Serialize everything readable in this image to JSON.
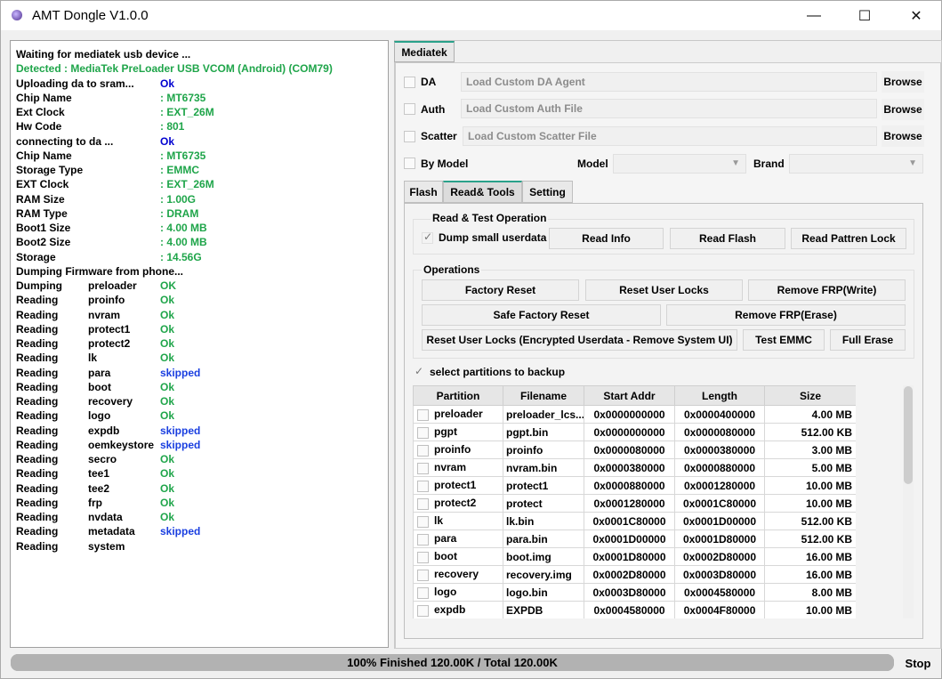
{
  "window": {
    "title": "AMT Dongle V1.0.0",
    "minimize": "—",
    "maximize": "☐",
    "close": "✕"
  },
  "log": [
    {
      "c1": "Waiting for mediatek usb device ...",
      "c2": "",
      "c3": "",
      "cls1": "",
      "cls3": ""
    },
    {
      "c1": "Detected  :  MediaTek PreLoader USB VCOM (Android) (COM79)",
      "c2": "",
      "c3": "",
      "cls1": "green",
      "cls3": ""
    },
    {
      "c1": "Uploading da to sram...",
      "c2": "",
      "c3": "Ok",
      "cls1": "",
      "cls3": "ok-blue"
    },
    {
      "c1": "Chip Name",
      "c2": "",
      "c3": ": MT6735",
      "cls1": "",
      "cls3": "ok-green"
    },
    {
      "c1": "Ext Clock",
      "c2": "",
      "c3": ": EXT_26M",
      "cls1": "",
      "cls3": "ok-green"
    },
    {
      "c1": "Hw Code",
      "c2": "",
      "c3": ": 801",
      "cls1": "",
      "cls3": "ok-green"
    },
    {
      "c1": "connecting to da ...",
      "c2": "",
      "c3": "Ok",
      "cls1": "",
      "cls3": "ok-blue"
    },
    {
      "c1": "Chip Name",
      "c2": "",
      "c3": ": MT6735",
      "cls1": "",
      "cls3": "ok-green"
    },
    {
      "c1": "Storage Type",
      "c2": "",
      "c3": ": EMMC",
      "cls1": "",
      "cls3": "ok-green"
    },
    {
      "c1": "EXT Clock",
      "c2": "",
      "c3": ": EXT_26M",
      "cls1": "",
      "cls3": "ok-green"
    },
    {
      "c1": "RAM Size",
      "c2": "",
      "c3": ": 1.00G",
      "cls1": "",
      "cls3": "ok-green"
    },
    {
      "c1": "RAM Type",
      "c2": "",
      "c3": ": DRAM",
      "cls1": "",
      "cls3": "ok-green"
    },
    {
      "c1": "Boot1 Size",
      "c2": "",
      "c3": ": 4.00 MB",
      "cls1": "",
      "cls3": "ok-green"
    },
    {
      "c1": "Boot2 Size",
      "c2": "",
      "c3": ": 4.00 MB",
      "cls1": "",
      "cls3": "ok-green"
    },
    {
      "c1": "Storage",
      "c2": "",
      "c3": ": 14.56G",
      "cls1": "",
      "cls3": "ok-green"
    },
    {
      "c1": "Dumping Firmware from phone...",
      "c2": "",
      "c3": "",
      "cls1": "",
      "cls3": ""
    },
    {
      "c1": "Dumping",
      "c2": "preloader",
      "c3": "OK",
      "cls1": "",
      "cls3": "ok-green"
    },
    {
      "c1": "Reading",
      "c2": "proinfo",
      "c3": "Ok",
      "cls1": "",
      "cls3": "ok-green"
    },
    {
      "c1": "Reading",
      "c2": "nvram",
      "c3": "Ok",
      "cls1": "",
      "cls3": "ok-green"
    },
    {
      "c1": "Reading",
      "c2": "protect1",
      "c3": "Ok",
      "cls1": "",
      "cls3": "ok-green"
    },
    {
      "c1": "Reading",
      "c2": "protect2",
      "c3": "Ok",
      "cls1": "",
      "cls3": "ok-green"
    },
    {
      "c1": "Reading",
      "c2": "lk",
      "c3": "Ok",
      "cls1": "",
      "cls3": "ok-green"
    },
    {
      "c1": "Reading",
      "c2": "para",
      "c3": "skipped",
      "cls1": "",
      "cls3": "skipped"
    },
    {
      "c1": "Reading",
      "c2": "boot",
      "c3": "Ok",
      "cls1": "",
      "cls3": "ok-green"
    },
    {
      "c1": "Reading",
      "c2": "recovery",
      "c3": "Ok",
      "cls1": "",
      "cls3": "ok-green"
    },
    {
      "c1": "Reading",
      "c2": "logo",
      "c3": "Ok",
      "cls1": "",
      "cls3": "ok-green"
    },
    {
      "c1": "Reading",
      "c2": "expdb",
      "c3": "skipped",
      "cls1": "",
      "cls3": "skipped"
    },
    {
      "c1": "Reading",
      "c2": "oemkeystore",
      "c3": "skipped",
      "cls1": "",
      "cls3": "skipped"
    },
    {
      "c1": "Reading",
      "c2": "secro",
      "c3": "Ok",
      "cls1": "",
      "cls3": "ok-green"
    },
    {
      "c1": "Reading",
      "c2": "tee1",
      "c3": "Ok",
      "cls1": "",
      "cls3": "ok-green"
    },
    {
      "c1": "Reading",
      "c2": "tee2",
      "c3": "Ok",
      "cls1": "",
      "cls3": "ok-green"
    },
    {
      "c1": "Reading",
      "c2": "frp",
      "c3": "Ok",
      "cls1": "",
      "cls3": "ok-green"
    },
    {
      "c1": "Reading",
      "c2": "nvdata",
      "c3": "Ok",
      "cls1": "",
      "cls3": "ok-green"
    },
    {
      "c1": "Reading",
      "c2": "metadata",
      "c3": "skipped",
      "cls1": "",
      "cls3": "skipped"
    },
    {
      "c1": "Reading",
      "c2": "system",
      "c3": "",
      "cls1": "",
      "cls3": ""
    }
  ],
  "main_tab": "Mediatek",
  "da": {
    "label": "DA",
    "placeholder": "Load Custom DA Agent",
    "browse": "Browse"
  },
  "auth": {
    "label": "Auth",
    "placeholder": "Load Custom Auth File",
    "browse": "Browse"
  },
  "scatter": {
    "label": "Scatter",
    "placeholder": "Load Custom Scatter File",
    "browse": "Browse"
  },
  "by_model": {
    "label": "By Model",
    "model_label": "Model",
    "brand_label": "Brand"
  },
  "sub_tabs": {
    "flash": "Flash",
    "read_tools": "Read& Tools",
    "setting": "Setting"
  },
  "read_test": {
    "title": "Read & Test Operation",
    "dump_small": "Dump small userdata",
    "read_info": "Read Info",
    "read_flash": "Read Flash",
    "read_pattern": "Read Pattren Lock"
  },
  "operations": {
    "title": "Operations",
    "factory_reset": "Factory Reset",
    "reset_user_locks": "Reset User Locks",
    "remove_frp_write": "Remove FRP(Write)",
    "safe_factory_reset": "Safe Factory Reset",
    "remove_frp_erase": "Remove FRP(Erase)",
    "reset_user_locks_enc": "Reset User Locks (Encrypted Userdata - Remove System UI)",
    "test_emmc": "Test EMMC",
    "full_erase": "Full Erase"
  },
  "select_partitions": "select partitions to backup",
  "table": {
    "headers": [
      "Partition",
      "Filename",
      "Start Addr",
      "Length",
      "Size"
    ],
    "rows": [
      [
        "preloader",
        "preloader_lcs...",
        "0x0000000000",
        "0x0000400000",
        "4.00 MB"
      ],
      [
        "pgpt",
        "pgpt.bin",
        "0x0000000000",
        "0x0000080000",
        "512.00 KB"
      ],
      [
        "proinfo",
        "proinfo",
        "0x0000080000",
        "0x0000380000",
        "3.00 MB"
      ],
      [
        "nvram",
        "nvram.bin",
        "0x0000380000",
        "0x0000880000",
        "5.00 MB"
      ],
      [
        "protect1",
        "protect1",
        "0x0000880000",
        "0x0001280000",
        "10.00 MB"
      ],
      [
        "protect2",
        "protect",
        "0x0001280000",
        "0x0001C80000",
        "10.00 MB"
      ],
      [
        "lk",
        "lk.bin",
        "0x0001C80000",
        "0x0001D00000",
        "512.00 KB"
      ],
      [
        "para",
        "para.bin",
        "0x0001D00000",
        "0x0001D80000",
        "512.00 KB"
      ],
      [
        "boot",
        "boot.img",
        "0x0001D80000",
        "0x0002D80000",
        "16.00 MB"
      ],
      [
        "recovery",
        "recovery.img",
        "0x0002D80000",
        "0x0003D80000",
        "16.00 MB"
      ],
      [
        "logo",
        "logo.bin",
        "0x0003D80000",
        "0x0004580000",
        "8.00 MB"
      ],
      [
        "expdb",
        "EXPDB",
        "0x0004580000",
        "0x0004F80000",
        "10.00 MB"
      ]
    ]
  },
  "progress": {
    "text": "100% Finished 120.00K / Total 120.00K",
    "percent": 100
  },
  "stop": "Stop",
  "colors": {
    "accent": "#2aa18a",
    "ok_green": "#1fa54a",
    "ok_blue": "#0000d0",
    "skipped": "#1a3fe0"
  }
}
